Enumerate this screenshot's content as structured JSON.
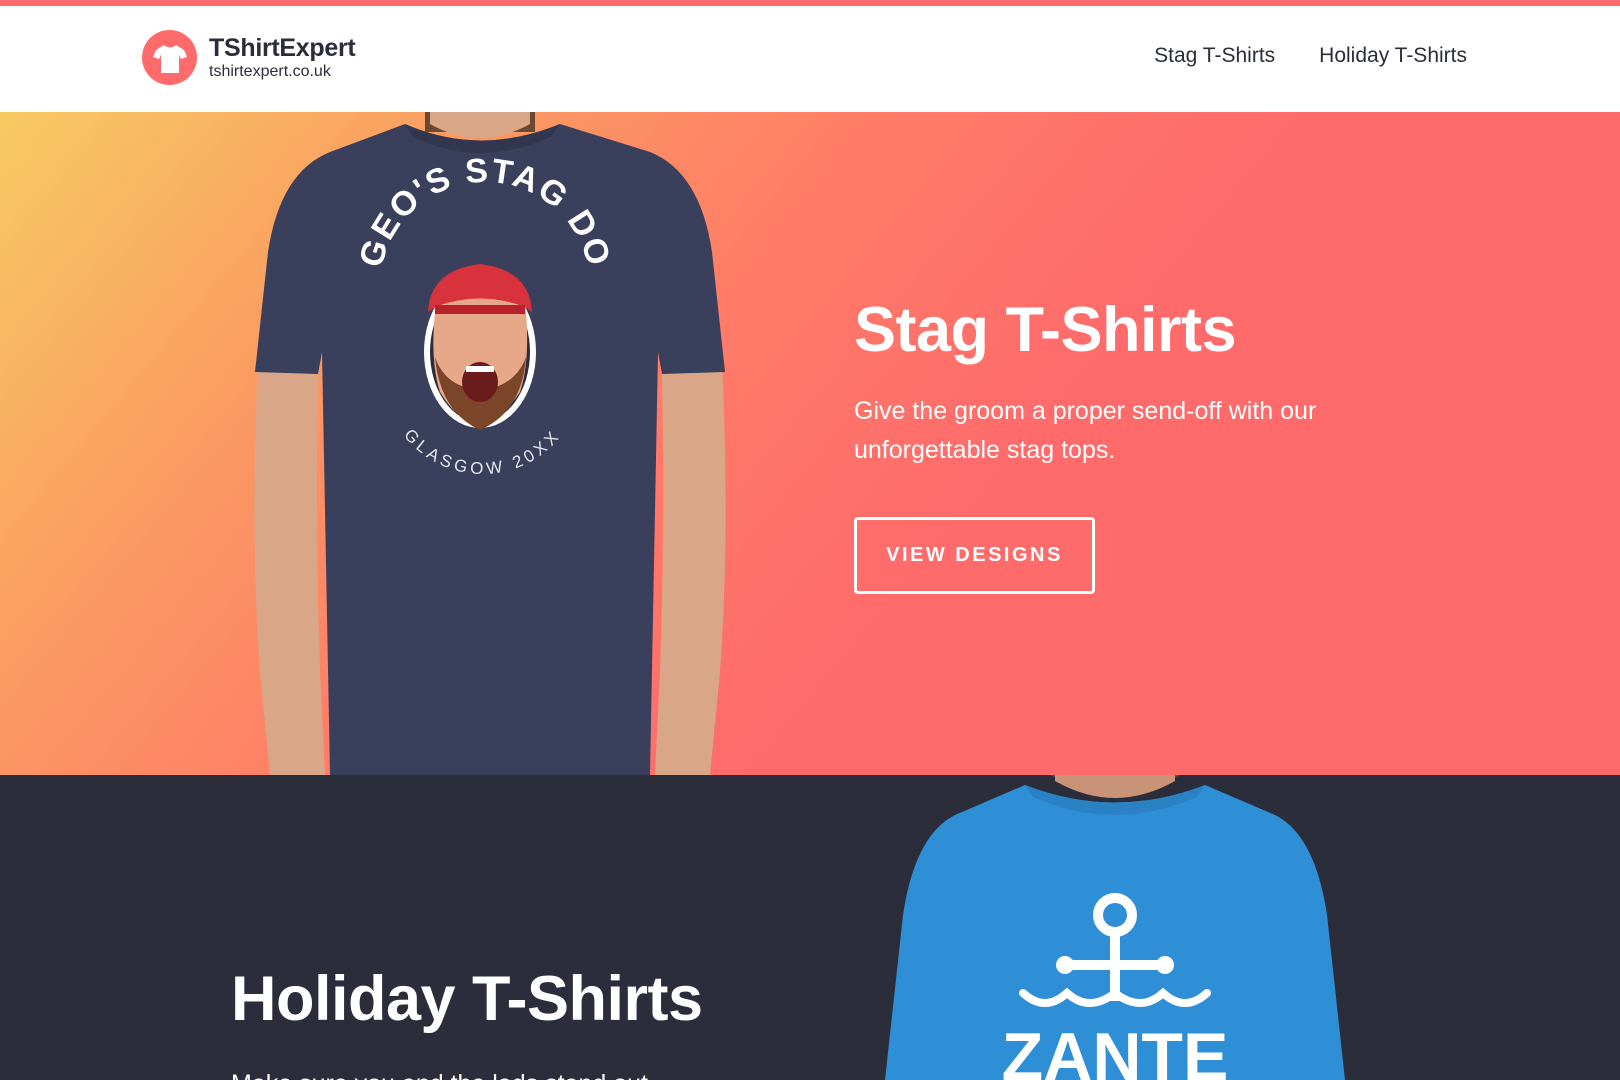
{
  "brand": {
    "name": "TShirtExpert",
    "url": "tshirtexpert.co.uk",
    "icon": "tshirt-icon",
    "accent": "#ff6b6b"
  },
  "nav": {
    "items": [
      {
        "label": "Stag T-Shirts"
      },
      {
        "label": "Holiday T-Shirts"
      }
    ]
  },
  "stag": {
    "title": "Stag T-Shirts",
    "description": "Give the groom a proper send-off with our unforgettable stag tops.",
    "cta_label": "VIEW DESIGNS",
    "shirt_color": "#3a3f5c",
    "print": {
      "top_text": "GEO'S STAG DO",
      "bottom_text": "GLASGOW 20XX"
    }
  },
  "holiday": {
    "title": "Holiday T-Shirts",
    "description": "Make sure you and the lads stand out",
    "shirt_color": "#2f8fd6",
    "print": {
      "text": "ZANTE",
      "icon": "anchor-icon"
    }
  },
  "colors": {
    "dark": "#2b2d3b",
    "gradient_start": "#f7cb62",
    "gradient_end": "#ff6b6b"
  }
}
